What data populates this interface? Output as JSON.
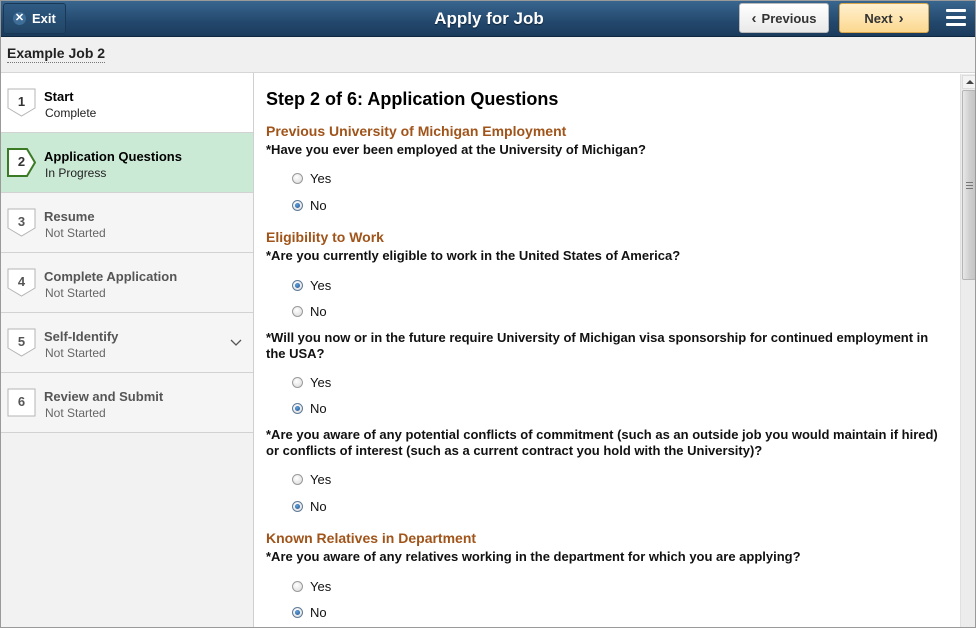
{
  "banner": {
    "exit_label": "Exit",
    "title": "Apply for Job",
    "previous_label": "Previous",
    "next_label": "Next"
  },
  "job_title": "Example Job 2",
  "steps": [
    {
      "number": "1",
      "label": "Start",
      "status": "Complete",
      "state": "complete"
    },
    {
      "number": "2",
      "label": "Application Questions",
      "status": "In Progress",
      "state": "active"
    },
    {
      "number": "3",
      "label": "Resume",
      "status": "Not Started",
      "state": "pending"
    },
    {
      "number": "4",
      "label": "Complete Application",
      "status": "Not Started",
      "state": "pending"
    },
    {
      "number": "5",
      "label": "Self-Identify",
      "status": "Not Started",
      "state": "pending",
      "expandable": true
    },
    {
      "number": "6",
      "label": "Review and Submit",
      "status": "Not Started",
      "state": "pending"
    }
  ],
  "content": {
    "heading": "Step 2 of 6: Application Questions",
    "sections": [
      {
        "title": "Previous University of Michigan Employment"
      },
      {
        "title": "Eligibility to Work"
      },
      {
        "title": "Known Relatives in Department"
      }
    ],
    "questions": [
      {
        "text": "*Have you ever been employed at the University of Michigan?",
        "options": [
          "Yes",
          "No"
        ],
        "selected": "No"
      },
      {
        "text": "*Are you currently eligible to work in the United States of America?",
        "options": [
          "Yes",
          "No"
        ],
        "selected": "Yes"
      },
      {
        "text": "*Will you now or in the future require University of Michigan visa sponsorship for continued employment in the USA?",
        "options": [
          "Yes",
          "No"
        ],
        "selected": "No"
      },
      {
        "text": "*Are you aware of any potential conflicts of commitment (such as an outside job you would maintain if hired) or conflicts of interest (such as a current contract you hold with the University)?",
        "options": [
          "Yes",
          "No"
        ],
        "selected": "No"
      },
      {
        "text": "*Are you aware of any relatives working in the department for which you are applying?",
        "options": [
          "Yes",
          "No"
        ],
        "selected": "No"
      }
    ]
  },
  "colors": {
    "banner": "#23486d",
    "section_title": "#a0541a",
    "active_step": "#cbead6",
    "active_badge": "#3b7a25",
    "next_button": "#fcd88f"
  },
  "icons": {
    "exit": "close-icon",
    "previous": "chevron-left-icon",
    "next": "chevron-right-icon",
    "menu": "hamburger-menu-icon",
    "expand": "chevron-down-icon"
  }
}
